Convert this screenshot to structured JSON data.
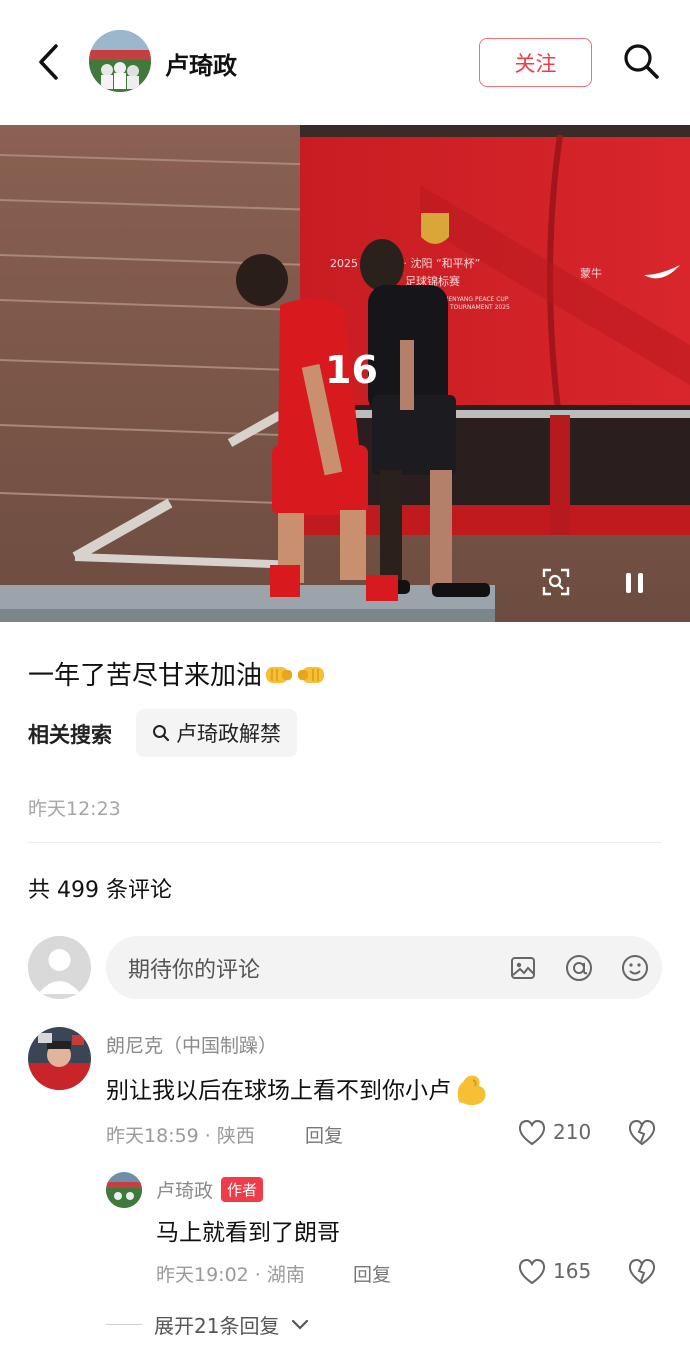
{
  "header": {
    "user_name": "卢琦政",
    "follow_label": "关注"
  },
  "post": {
    "text": "一年了苦尽甘来加油",
    "related_label": "相关搜索",
    "related_query": "卢琦政解禁",
    "timestamp": "昨天12:23",
    "image_texts": {
      "banner_line1": "2025",
      "banner_line2": "之队 · 沈阳 “和平杯”",
      "banner_line3": "足球锦标赛",
      "banner_en": "SHENYANG PEACE CUP",
      "banner_en2": "TOURNAMENT 2025",
      "sponsor": "蒙牛",
      "jersey_number": "16"
    }
  },
  "comments_section": {
    "count_label": "共 499 条评论",
    "input_placeholder": "期待你的评论"
  },
  "comments": [
    {
      "name": "朗尼克（中国制躁）",
      "text": "别让我以后在球场上看不到你小卢",
      "time": "昨天18:59",
      "location": "陕西",
      "reply_label": "回复",
      "likes": "210"
    }
  ],
  "reply": {
    "name": "卢琦政",
    "badge": "作者",
    "text": "马上就看到了朗哥",
    "time": "昨天19:02",
    "location": "湖南",
    "reply_label": "回复",
    "likes": "165"
  },
  "expand_label": "展开21条回复",
  "colors": {
    "accent": "#ef3b4a",
    "muted": "#9a9a9a"
  }
}
